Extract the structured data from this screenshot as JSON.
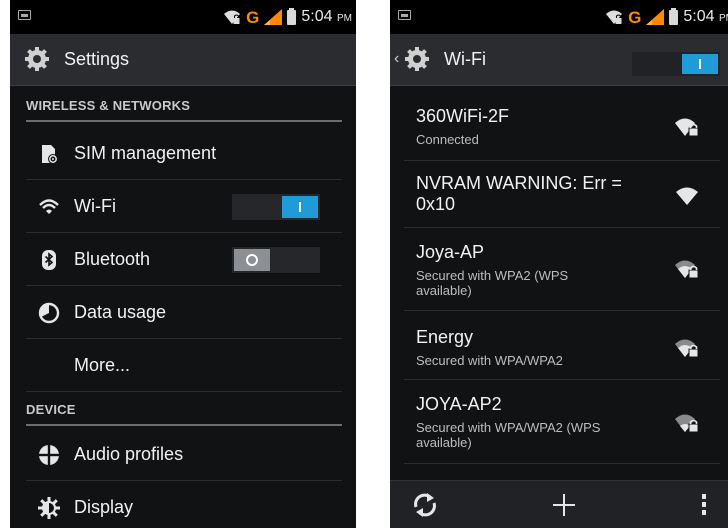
{
  "status_bar": {
    "network_letter": "G",
    "time": "5:04",
    "time_suffix": "PM"
  },
  "settings_screen": {
    "title": "Settings",
    "sections": {
      "wireless": "WIRELESS & NETWORKS",
      "device": "DEVICE"
    },
    "items": {
      "sim": "SIM management",
      "wifi": "Wi-Fi",
      "bluetooth": "Bluetooth",
      "data_usage": "Data usage",
      "more": "More...",
      "audio_profiles": "Audio profiles",
      "display": "Display"
    },
    "toggles": {
      "wifi": "on",
      "bluetooth": "off"
    }
  },
  "wifi_screen": {
    "title": "Wi-Fi",
    "toggle": "on",
    "networks": [
      {
        "ssid": "360WiFi-2F",
        "status": "Connected",
        "secured": true
      },
      {
        "ssid": "NVRAM WARNING: Err = 0x10",
        "status": "",
        "secured": false
      },
      {
        "ssid": "Joya-AP",
        "status": "Secured with WPA2 (WPS available)",
        "secured": true
      },
      {
        "ssid": "Energy",
        "status": "Secured with WPA/WPA2",
        "secured": true
      },
      {
        "ssid": "JOYA-AP2",
        "status": "Secured with WPA/WPA2 (WPS available)",
        "secured": true
      }
    ]
  },
  "colors": {
    "accent": "#1f9bd8",
    "carrier": "#ff8a00",
    "background": "#111214",
    "action_bar": "#2a2c2f"
  }
}
